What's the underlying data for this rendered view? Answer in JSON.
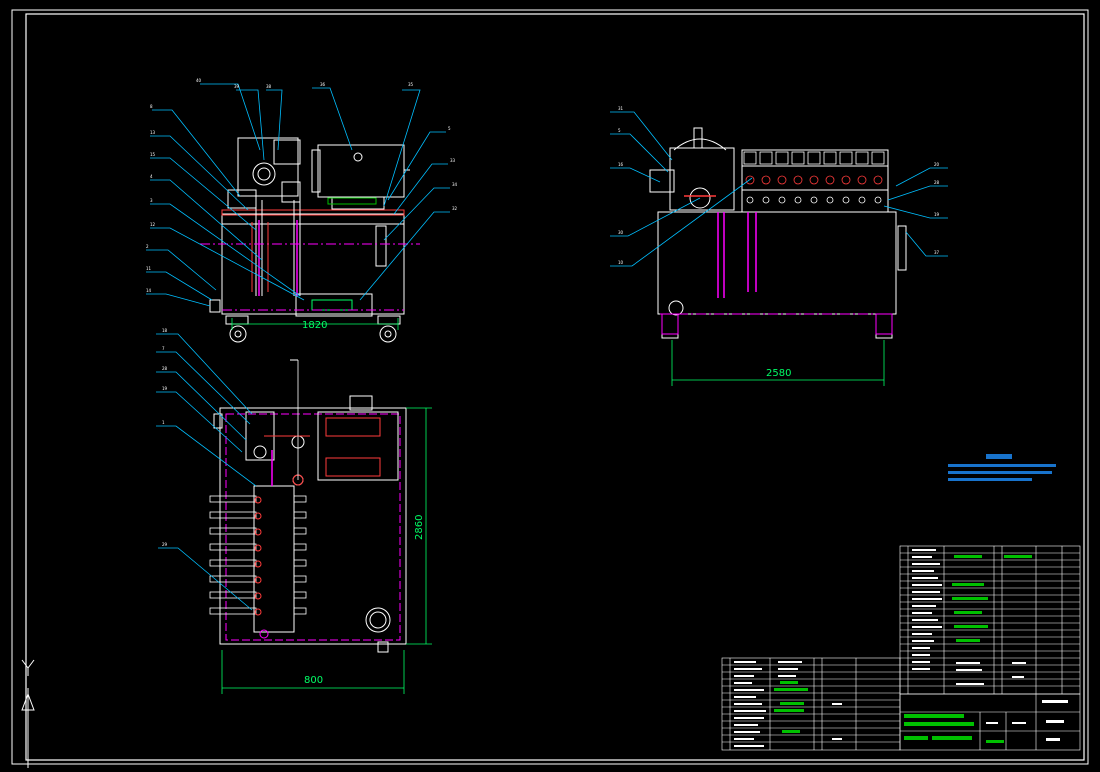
{
  "dimensions": {
    "front_width": "1820",
    "side_width": "2580",
    "top_depth": "2860",
    "top_width": "800"
  },
  "axis_label": "Y",
  "colors": {
    "background": "#000000",
    "geometry": "#ffffff",
    "dimension": "#00ff66",
    "leader": "#00bfff",
    "centerline": "#ff00ff",
    "hatch": "#00c000",
    "note": "#1e90ff",
    "accent": "#ff3b3b"
  }
}
